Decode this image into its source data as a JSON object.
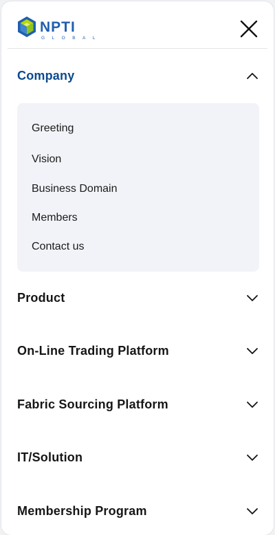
{
  "header": {
    "logo_text": "NPTI",
    "logo_subtext": "GLOBAL"
  },
  "menu": {
    "company": {
      "label": "Company",
      "expanded": true,
      "items": [
        "Greeting",
        "Vision",
        "Business Domain",
        "Members",
        "Contact us"
      ]
    },
    "product": {
      "label": "Product"
    },
    "online_trading": {
      "label": "On-Line Trading Platform"
    },
    "fabric_sourcing": {
      "label": "Fabric Sourcing Platform"
    },
    "it_solution": {
      "label": "IT/Solution"
    },
    "membership": {
      "label": "Membership Program"
    }
  },
  "colors": {
    "active_menu": "#0c4a8e",
    "logo_blue": "#1f5fae",
    "logo_lime": "#b9d800",
    "submenu_bg": "#f1f3f8"
  },
  "icons": {
    "expanded": "chevron-up-icon",
    "collapsed": "chevron-down-icon",
    "close": "close-icon"
  }
}
